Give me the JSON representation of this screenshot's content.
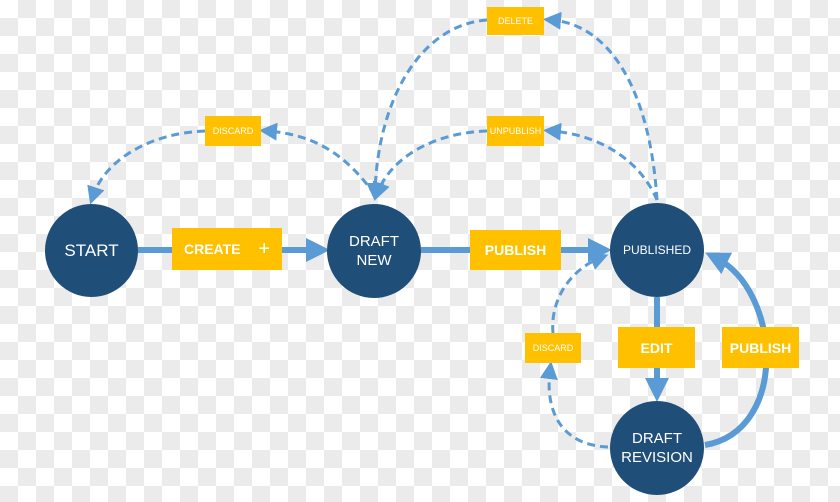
{
  "nodes": {
    "start": "START",
    "draft_new_1": "DRAFT",
    "draft_new_2": "NEW",
    "published": "PUBLISHED",
    "draft_revision_1": "DRAFT",
    "draft_revision_2": "REVISION"
  },
  "transitions": {
    "create": "CREATE",
    "create_icon": "+",
    "publish": "PUBLISH",
    "discard_new": "DISCARD",
    "delete": "DELETE",
    "unpublish": "UNPUBLISH",
    "discard_revision": "DISCARD",
    "edit": "EDIT",
    "publish_revision": "PUBLISH"
  },
  "colors": {
    "node": "#1f4e79",
    "label": "#ffc000",
    "arrow": "#5b9bd5"
  }
}
